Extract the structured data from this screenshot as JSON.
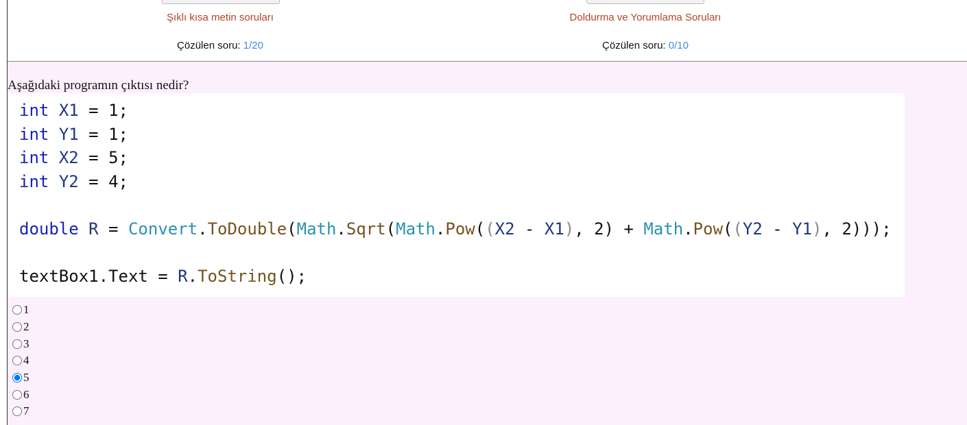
{
  "categories": [
    {
      "title": "Şıklı kısa metin soruları",
      "count_label": "Çözülen soru:",
      "count": "1/20"
    },
    {
      "title": "Doldurma ve Yorumlama Soruları",
      "count_label": "Çözülen soru:",
      "count": "0/10"
    }
  ],
  "question": "Aşağıdaki programın çıktısı nedir?",
  "code_lines": [
    [
      [
        "kw",
        "int"
      ],
      [
        "p",
        " "
      ],
      [
        "id",
        "X1"
      ],
      [
        "p",
        " = 1;"
      ]
    ],
    [
      [
        "kw",
        "int"
      ],
      [
        "p",
        " "
      ],
      [
        "id",
        "Y1"
      ],
      [
        "p",
        " = 1;"
      ]
    ],
    [
      [
        "kw",
        "int"
      ],
      [
        "p",
        " "
      ],
      [
        "id",
        "X2"
      ],
      [
        "p",
        " = 5;"
      ]
    ],
    [
      [
        "kw",
        "int"
      ],
      [
        "p",
        " "
      ],
      [
        "id",
        "Y2"
      ],
      [
        "p",
        " = 4;"
      ]
    ],
    [],
    [
      [
        "kw",
        "double"
      ],
      [
        "p",
        " "
      ],
      [
        "id",
        "R"
      ],
      [
        "p",
        " = "
      ],
      [
        "cls",
        "Convert"
      ],
      [
        "p",
        "."
      ],
      [
        "mth",
        "ToDouble"
      ],
      [
        "p",
        "("
      ],
      [
        "cls",
        "Math"
      ],
      [
        "p",
        "."
      ],
      [
        "mth",
        "Sqrt"
      ],
      [
        "p",
        "("
      ],
      [
        "cls",
        "Math"
      ],
      [
        "p",
        "."
      ],
      [
        "mth",
        "Pow"
      ],
      [
        "p",
        "("
      ],
      [
        "pp",
        "("
      ],
      [
        "id",
        "X2"
      ],
      [
        "p",
        " - "
      ],
      [
        "id",
        "X1"
      ],
      [
        "pp",
        ")"
      ],
      [
        "p",
        ", 2) + "
      ],
      [
        "cls",
        "Math"
      ],
      [
        "p",
        "."
      ],
      [
        "mth",
        "Pow"
      ],
      [
        "p",
        "("
      ],
      [
        "pp",
        "("
      ],
      [
        "id",
        "Y2"
      ],
      [
        "p",
        " - "
      ],
      [
        "id",
        "Y1"
      ],
      [
        "pp",
        ")"
      ],
      [
        "p",
        ", 2)));"
      ]
    ],
    [],
    [
      [
        "p",
        "textBox1.Text = "
      ],
      [
        "id",
        "R"
      ],
      [
        "p",
        "."
      ],
      [
        "mth",
        "ToString"
      ],
      [
        "p",
        "();"
      ]
    ]
  ],
  "options": [
    "1",
    "2",
    "3",
    "4",
    "5",
    "6",
    "7"
  ],
  "selected_option": "5"
}
